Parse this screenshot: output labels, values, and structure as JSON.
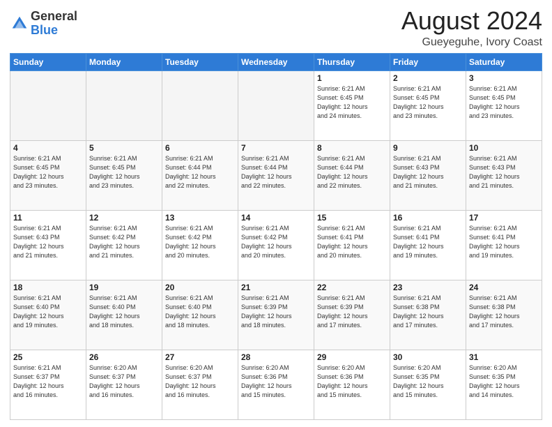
{
  "logo": {
    "general": "General",
    "blue": "Blue"
  },
  "header": {
    "title": "August 2024",
    "subtitle": "Gueyeguhe, Ivory Coast"
  },
  "days_of_week": [
    "Sunday",
    "Monday",
    "Tuesday",
    "Wednesday",
    "Thursday",
    "Friday",
    "Saturday"
  ],
  "weeks": [
    [
      {
        "day": "",
        "info": ""
      },
      {
        "day": "",
        "info": ""
      },
      {
        "day": "",
        "info": ""
      },
      {
        "day": "",
        "info": ""
      },
      {
        "day": "1",
        "info": "Sunrise: 6:21 AM\nSunset: 6:45 PM\nDaylight: 12 hours\nand 24 minutes."
      },
      {
        "day": "2",
        "info": "Sunrise: 6:21 AM\nSunset: 6:45 PM\nDaylight: 12 hours\nand 23 minutes."
      },
      {
        "day": "3",
        "info": "Sunrise: 6:21 AM\nSunset: 6:45 PM\nDaylight: 12 hours\nand 23 minutes."
      }
    ],
    [
      {
        "day": "4",
        "info": "Sunrise: 6:21 AM\nSunset: 6:45 PM\nDaylight: 12 hours\nand 23 minutes."
      },
      {
        "day": "5",
        "info": "Sunrise: 6:21 AM\nSunset: 6:45 PM\nDaylight: 12 hours\nand 23 minutes."
      },
      {
        "day": "6",
        "info": "Sunrise: 6:21 AM\nSunset: 6:44 PM\nDaylight: 12 hours\nand 22 minutes."
      },
      {
        "day": "7",
        "info": "Sunrise: 6:21 AM\nSunset: 6:44 PM\nDaylight: 12 hours\nand 22 minutes."
      },
      {
        "day": "8",
        "info": "Sunrise: 6:21 AM\nSunset: 6:44 PM\nDaylight: 12 hours\nand 22 minutes."
      },
      {
        "day": "9",
        "info": "Sunrise: 6:21 AM\nSunset: 6:43 PM\nDaylight: 12 hours\nand 21 minutes."
      },
      {
        "day": "10",
        "info": "Sunrise: 6:21 AM\nSunset: 6:43 PM\nDaylight: 12 hours\nand 21 minutes."
      }
    ],
    [
      {
        "day": "11",
        "info": "Sunrise: 6:21 AM\nSunset: 6:43 PM\nDaylight: 12 hours\nand 21 minutes."
      },
      {
        "day": "12",
        "info": "Sunrise: 6:21 AM\nSunset: 6:42 PM\nDaylight: 12 hours\nand 21 minutes."
      },
      {
        "day": "13",
        "info": "Sunrise: 6:21 AM\nSunset: 6:42 PM\nDaylight: 12 hours\nand 20 minutes."
      },
      {
        "day": "14",
        "info": "Sunrise: 6:21 AM\nSunset: 6:42 PM\nDaylight: 12 hours\nand 20 minutes."
      },
      {
        "day": "15",
        "info": "Sunrise: 6:21 AM\nSunset: 6:41 PM\nDaylight: 12 hours\nand 20 minutes."
      },
      {
        "day": "16",
        "info": "Sunrise: 6:21 AM\nSunset: 6:41 PM\nDaylight: 12 hours\nand 19 minutes."
      },
      {
        "day": "17",
        "info": "Sunrise: 6:21 AM\nSunset: 6:41 PM\nDaylight: 12 hours\nand 19 minutes."
      }
    ],
    [
      {
        "day": "18",
        "info": "Sunrise: 6:21 AM\nSunset: 6:40 PM\nDaylight: 12 hours\nand 19 minutes."
      },
      {
        "day": "19",
        "info": "Sunrise: 6:21 AM\nSunset: 6:40 PM\nDaylight: 12 hours\nand 18 minutes."
      },
      {
        "day": "20",
        "info": "Sunrise: 6:21 AM\nSunset: 6:40 PM\nDaylight: 12 hours\nand 18 minutes."
      },
      {
        "day": "21",
        "info": "Sunrise: 6:21 AM\nSunset: 6:39 PM\nDaylight: 12 hours\nand 18 minutes."
      },
      {
        "day": "22",
        "info": "Sunrise: 6:21 AM\nSunset: 6:39 PM\nDaylight: 12 hours\nand 17 minutes."
      },
      {
        "day": "23",
        "info": "Sunrise: 6:21 AM\nSunset: 6:38 PM\nDaylight: 12 hours\nand 17 minutes."
      },
      {
        "day": "24",
        "info": "Sunrise: 6:21 AM\nSunset: 6:38 PM\nDaylight: 12 hours\nand 17 minutes."
      }
    ],
    [
      {
        "day": "25",
        "info": "Sunrise: 6:21 AM\nSunset: 6:37 PM\nDaylight: 12 hours\nand 16 minutes."
      },
      {
        "day": "26",
        "info": "Sunrise: 6:20 AM\nSunset: 6:37 PM\nDaylight: 12 hours\nand 16 minutes."
      },
      {
        "day": "27",
        "info": "Sunrise: 6:20 AM\nSunset: 6:37 PM\nDaylight: 12 hours\nand 16 minutes."
      },
      {
        "day": "28",
        "info": "Sunrise: 6:20 AM\nSunset: 6:36 PM\nDaylight: 12 hours\nand 15 minutes."
      },
      {
        "day": "29",
        "info": "Sunrise: 6:20 AM\nSunset: 6:36 PM\nDaylight: 12 hours\nand 15 minutes."
      },
      {
        "day": "30",
        "info": "Sunrise: 6:20 AM\nSunset: 6:35 PM\nDaylight: 12 hours\nand 15 minutes."
      },
      {
        "day": "31",
        "info": "Sunrise: 6:20 AM\nSunset: 6:35 PM\nDaylight: 12 hours\nand 14 minutes."
      }
    ]
  ]
}
